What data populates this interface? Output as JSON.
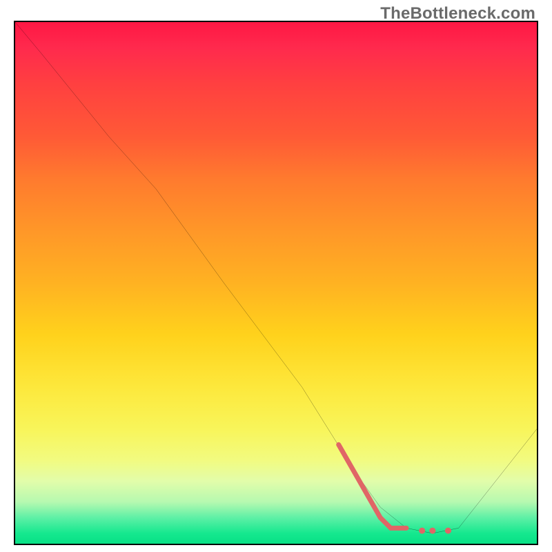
{
  "watermark": "TheBottleneck.com",
  "chart_data": {
    "type": "line",
    "title": "",
    "xlabel": "",
    "ylabel": "",
    "xlim": [
      0,
      100
    ],
    "ylim": [
      0,
      100
    ],
    "grid": false,
    "legend": false,
    "series": [
      {
        "name": "curve",
        "color": "#000000",
        "x": [
          0,
          5,
          18,
          27,
          40,
          55,
          65,
          70,
          75,
          80,
          85,
          100
        ],
        "y": [
          100,
          94,
          78,
          68,
          50,
          30,
          14,
          7,
          3,
          2,
          3,
          22
        ]
      },
      {
        "name": "highlight-segment",
        "color": "#e06666",
        "x": [
          62,
          70,
          72,
          75
        ],
        "y": [
          19,
          5,
          3,
          3
        ]
      },
      {
        "name": "highlight-dots",
        "color": "#e06666",
        "type_override": "scatter",
        "x": [
          78,
          80,
          83
        ],
        "y": [
          2.5,
          2.5,
          2.5
        ]
      }
    ]
  }
}
